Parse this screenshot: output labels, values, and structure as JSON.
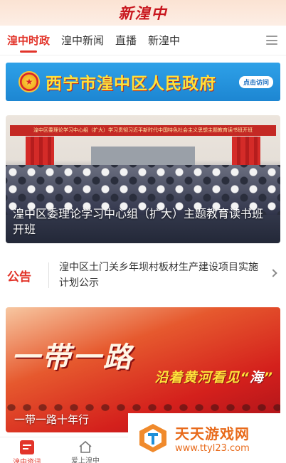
{
  "header": {
    "logo_text": "新湟中"
  },
  "tabs": [
    {
      "label": "湟中时政",
      "active": true
    },
    {
      "label": "湟中新闻",
      "active": false
    },
    {
      "label": "直播",
      "active": false
    },
    {
      "label": "新湟中",
      "active": false
    }
  ],
  "gov_banner": {
    "title": "西宁市湟中区人民政府",
    "visit_label": "点击访问"
  },
  "hero_news": {
    "banner_text": "湟中区委理论学习中心组（扩大）学习贯彻习近平新时代中国特色社会主义思想主题教育读书班开班",
    "caption": "湟中区委理论学习中心组（扩大）主题教育读书班开班"
  },
  "notice": {
    "label": "公告",
    "text": "湟中区土门关乡年坝村板材生产建设项目实施计划公示"
  },
  "feature": {
    "calligraphy": "一带一路",
    "slogan_prefix": "沿着黄河看见“",
    "slogan_highlight": "海",
    "slogan_suffix": "”",
    "caption": "一带一路十年行"
  },
  "bottom_nav": [
    {
      "label": "湟中资讯",
      "icon": "news-icon",
      "active": true
    },
    {
      "label": "爱上湟中",
      "icon": "home-icon",
      "active": false
    }
  ],
  "watermark": {
    "name": "天天游戏网",
    "url": "www.ttyl23.com"
  },
  "colors": {
    "accent": "#e2342a",
    "gov_banner_blue": "#1d86d2",
    "gov_title_yellow": "#ffe23a"
  }
}
